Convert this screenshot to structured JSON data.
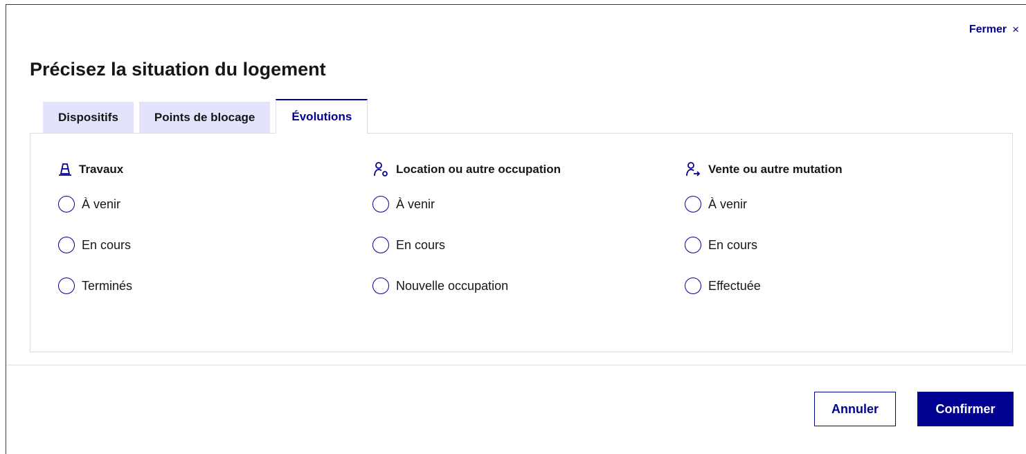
{
  "modal": {
    "close_label": "Fermer",
    "close_glyph": "×",
    "title": "Précisez la situation du logement"
  },
  "tabs": [
    {
      "label": "Dispositifs",
      "active": false
    },
    {
      "label": "Points de blocage",
      "active": false
    },
    {
      "label": "Évolutions",
      "active": true
    }
  ],
  "columns": [
    {
      "heading": "Travaux",
      "icon": "road-cone-icon",
      "options": [
        "À venir",
        "En cours",
        "Terminés"
      ]
    },
    {
      "heading": "Location ou autre occupation",
      "icon": "user-key-icon",
      "options": [
        "À venir",
        "En cours",
        "Nouvelle occupation"
      ]
    },
    {
      "heading": "Vente ou autre mutation",
      "icon": "user-arrow-icon",
      "options": [
        "À venir",
        "En cours",
        "Effectuée"
      ]
    }
  ],
  "footer": {
    "cancel_label": "Annuler",
    "confirm_label": "Confirmer"
  },
  "colors": {
    "primary": "#000091",
    "tab_inactive_bg": "#e3e3fd",
    "border": "#dddddd"
  }
}
